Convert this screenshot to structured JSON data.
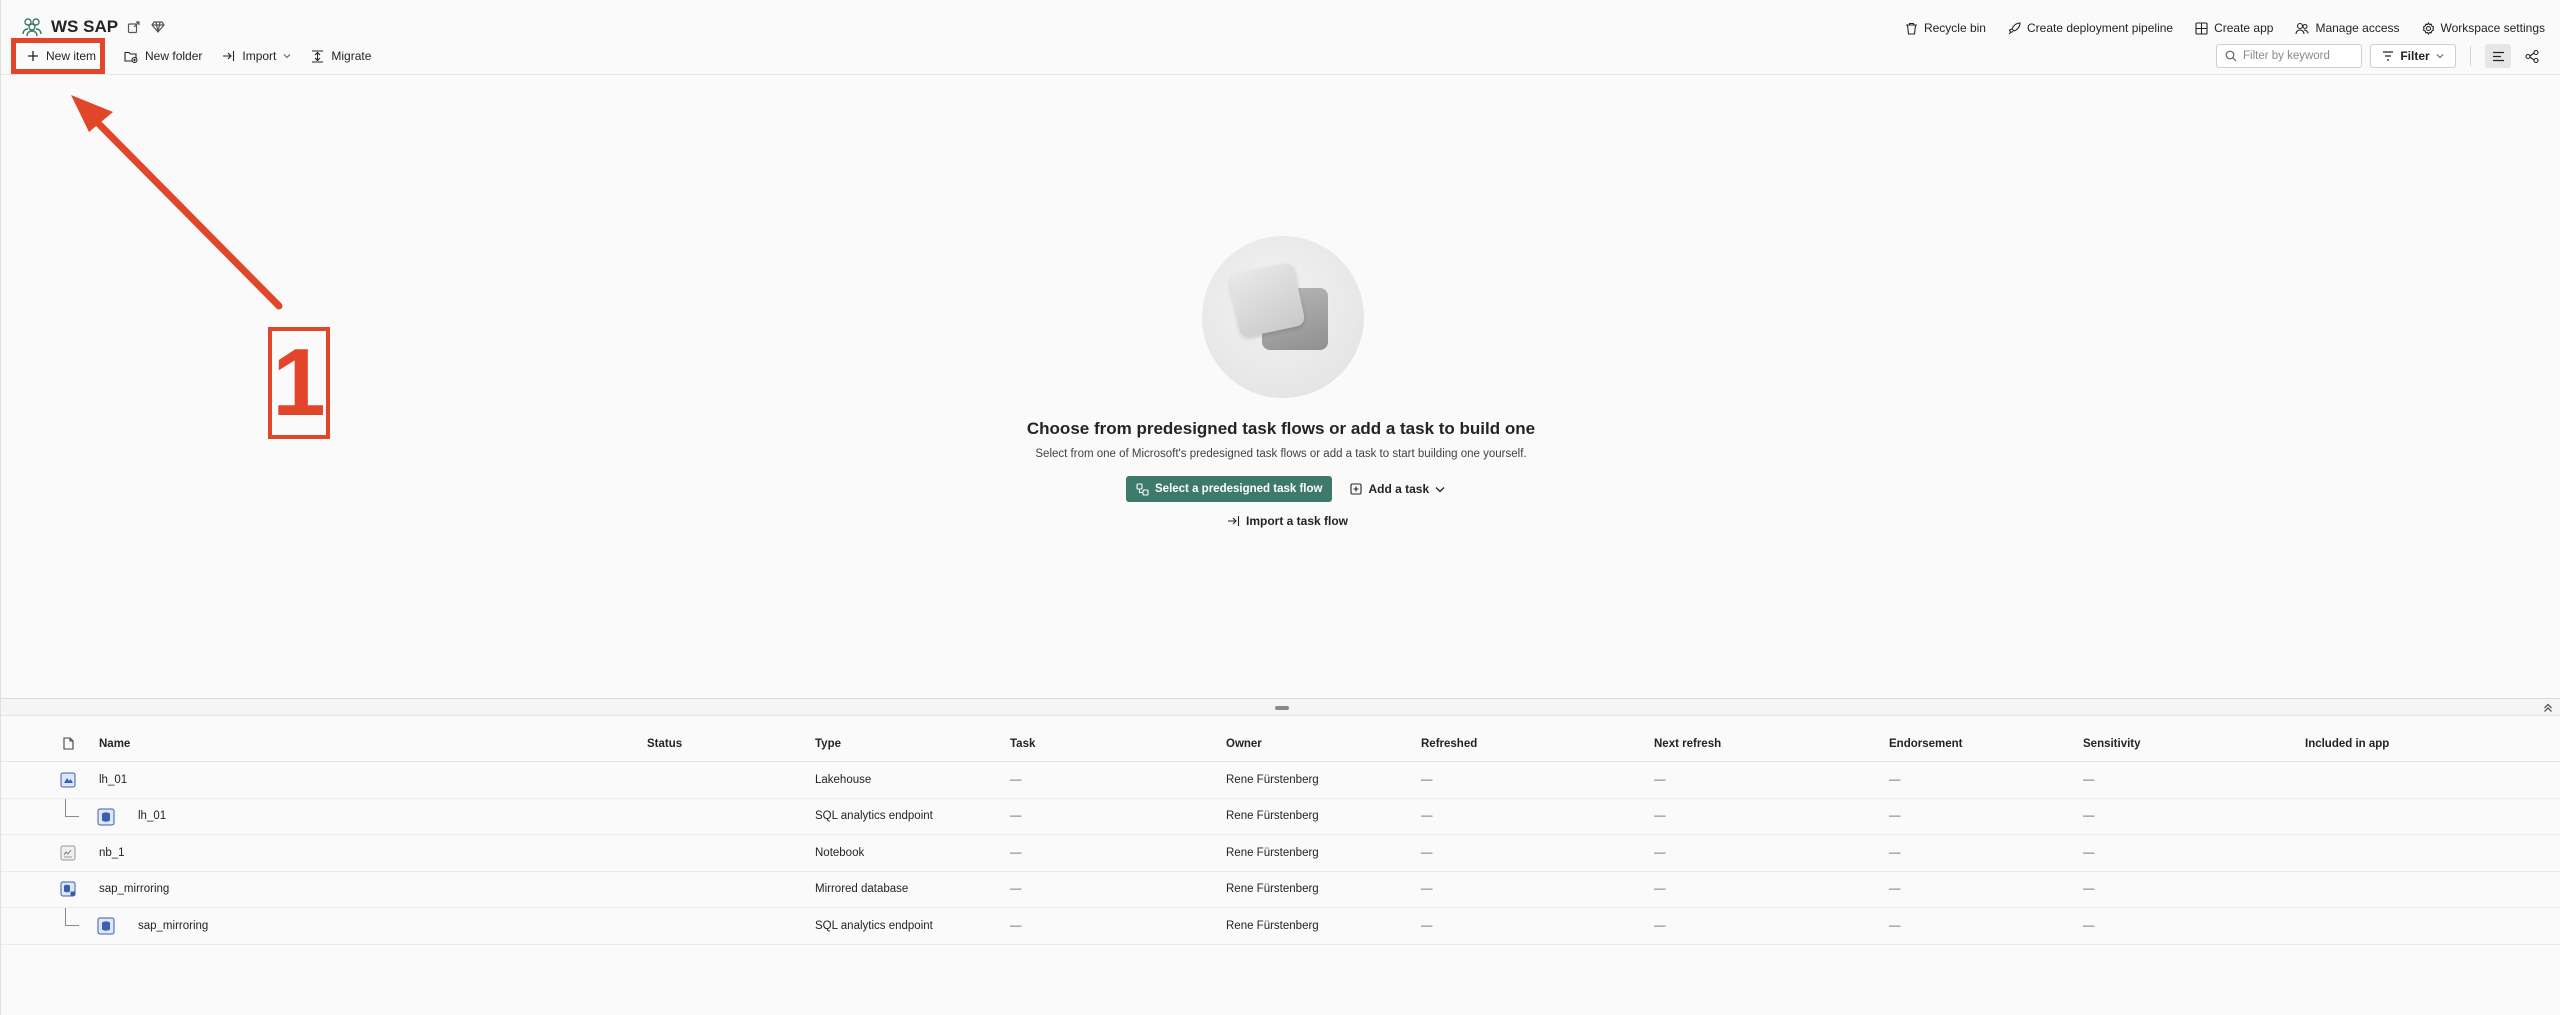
{
  "workspace": {
    "name": "WS SAP",
    "icon": "workspace-people-icon",
    "extra_icons": [
      "share-icon",
      "diamond-icon"
    ]
  },
  "toolbar": {
    "new_item": "New item",
    "new_folder": "New folder",
    "import": "Import",
    "migrate": "Migrate"
  },
  "actions": {
    "recycle_bin": "Recycle bin",
    "create_pipeline": "Create deployment pipeline",
    "create_app": "Create app",
    "manage_access": "Manage access",
    "workspace_settings": "Workspace settings"
  },
  "search": {
    "placeholder": "Filter by keyword"
  },
  "filter": {
    "label": "Filter"
  },
  "empty_state": {
    "title": "Choose from predesigned task flows or add a task to build one",
    "subtitle": "Select from one of Microsoft's predesigned task flows or add a task to start building one yourself.",
    "primary_button": "Select a predesigned task flow",
    "add_task": "Add a task",
    "import_flow": "Import a task flow"
  },
  "annotation": {
    "number": "1",
    "color": "#e2462a"
  },
  "table": {
    "columns": {
      "name": "Name",
      "status": "Status",
      "type": "Type",
      "task": "Task",
      "owner": "Owner",
      "refreshed": "Refreshed",
      "next_refresh": "Next refresh",
      "endorsement": "Endorsement",
      "sensitivity": "Sensitivity",
      "included_in_app": "Included in app"
    },
    "rows": [
      {
        "name": "lh_01",
        "type": "Lakehouse",
        "task": "—",
        "owner": "Rene Fürstenberg",
        "refreshed": "—",
        "next_refresh": "—",
        "endorsement": "—",
        "sensitivity": "—",
        "child": false,
        "icon": "lakehouse-icon"
      },
      {
        "name": "lh_01",
        "type": "SQL analytics endpoint",
        "task": "—",
        "owner": "Rene Fürstenberg",
        "refreshed": "—",
        "next_refresh": "—",
        "endorsement": "—",
        "sensitivity": "—",
        "child": true,
        "icon": "sql-endpoint-icon"
      },
      {
        "name": "nb_1",
        "type": "Notebook",
        "task": "—",
        "owner": "Rene Fürstenberg",
        "refreshed": "—",
        "next_refresh": "—",
        "endorsement": "—",
        "sensitivity": "—",
        "child": false,
        "icon": "notebook-icon"
      },
      {
        "name": "sap_mirroring",
        "type": "Mirrored database",
        "task": "—",
        "owner": "Rene Fürstenberg",
        "refreshed": "—",
        "next_refresh": "—",
        "endorsement": "—",
        "sensitivity": "—",
        "child": false,
        "icon": "mirrored-database-icon"
      },
      {
        "name": "sap_mirroring",
        "type": "SQL analytics endpoint",
        "task": "—",
        "owner": "Rene Fürstenberg",
        "refreshed": "—",
        "next_refresh": "—",
        "endorsement": "—",
        "sensitivity": "—",
        "child": true,
        "icon": "sql-endpoint-icon"
      }
    ]
  },
  "colors": {
    "accent": "#3e7a6b",
    "annotation": "#e2462a",
    "item_icon": "#3b5fb0"
  }
}
